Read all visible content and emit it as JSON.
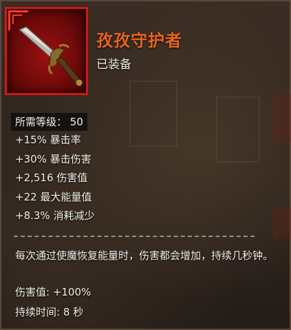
{
  "item": {
    "name": "孜孜守护者",
    "status": "已装备",
    "icon": "dagger-icon",
    "name_color": "#e8641e",
    "frame_color": "#d01818"
  },
  "requirement": "所需等级：  50",
  "stats": [
    "+15%  暴击率",
    "+30%  暴击伤害",
    "+2,516  伤害值",
    "+22  最大能量值",
    "+8.3%  消耗减少"
  ],
  "effect": {
    "description": "每次通过使魔恢复能量时，伤害都会增加，持续几秒钟。",
    "damage": "伤害值: +100%",
    "duration": "持续时间: 8 秒"
  }
}
